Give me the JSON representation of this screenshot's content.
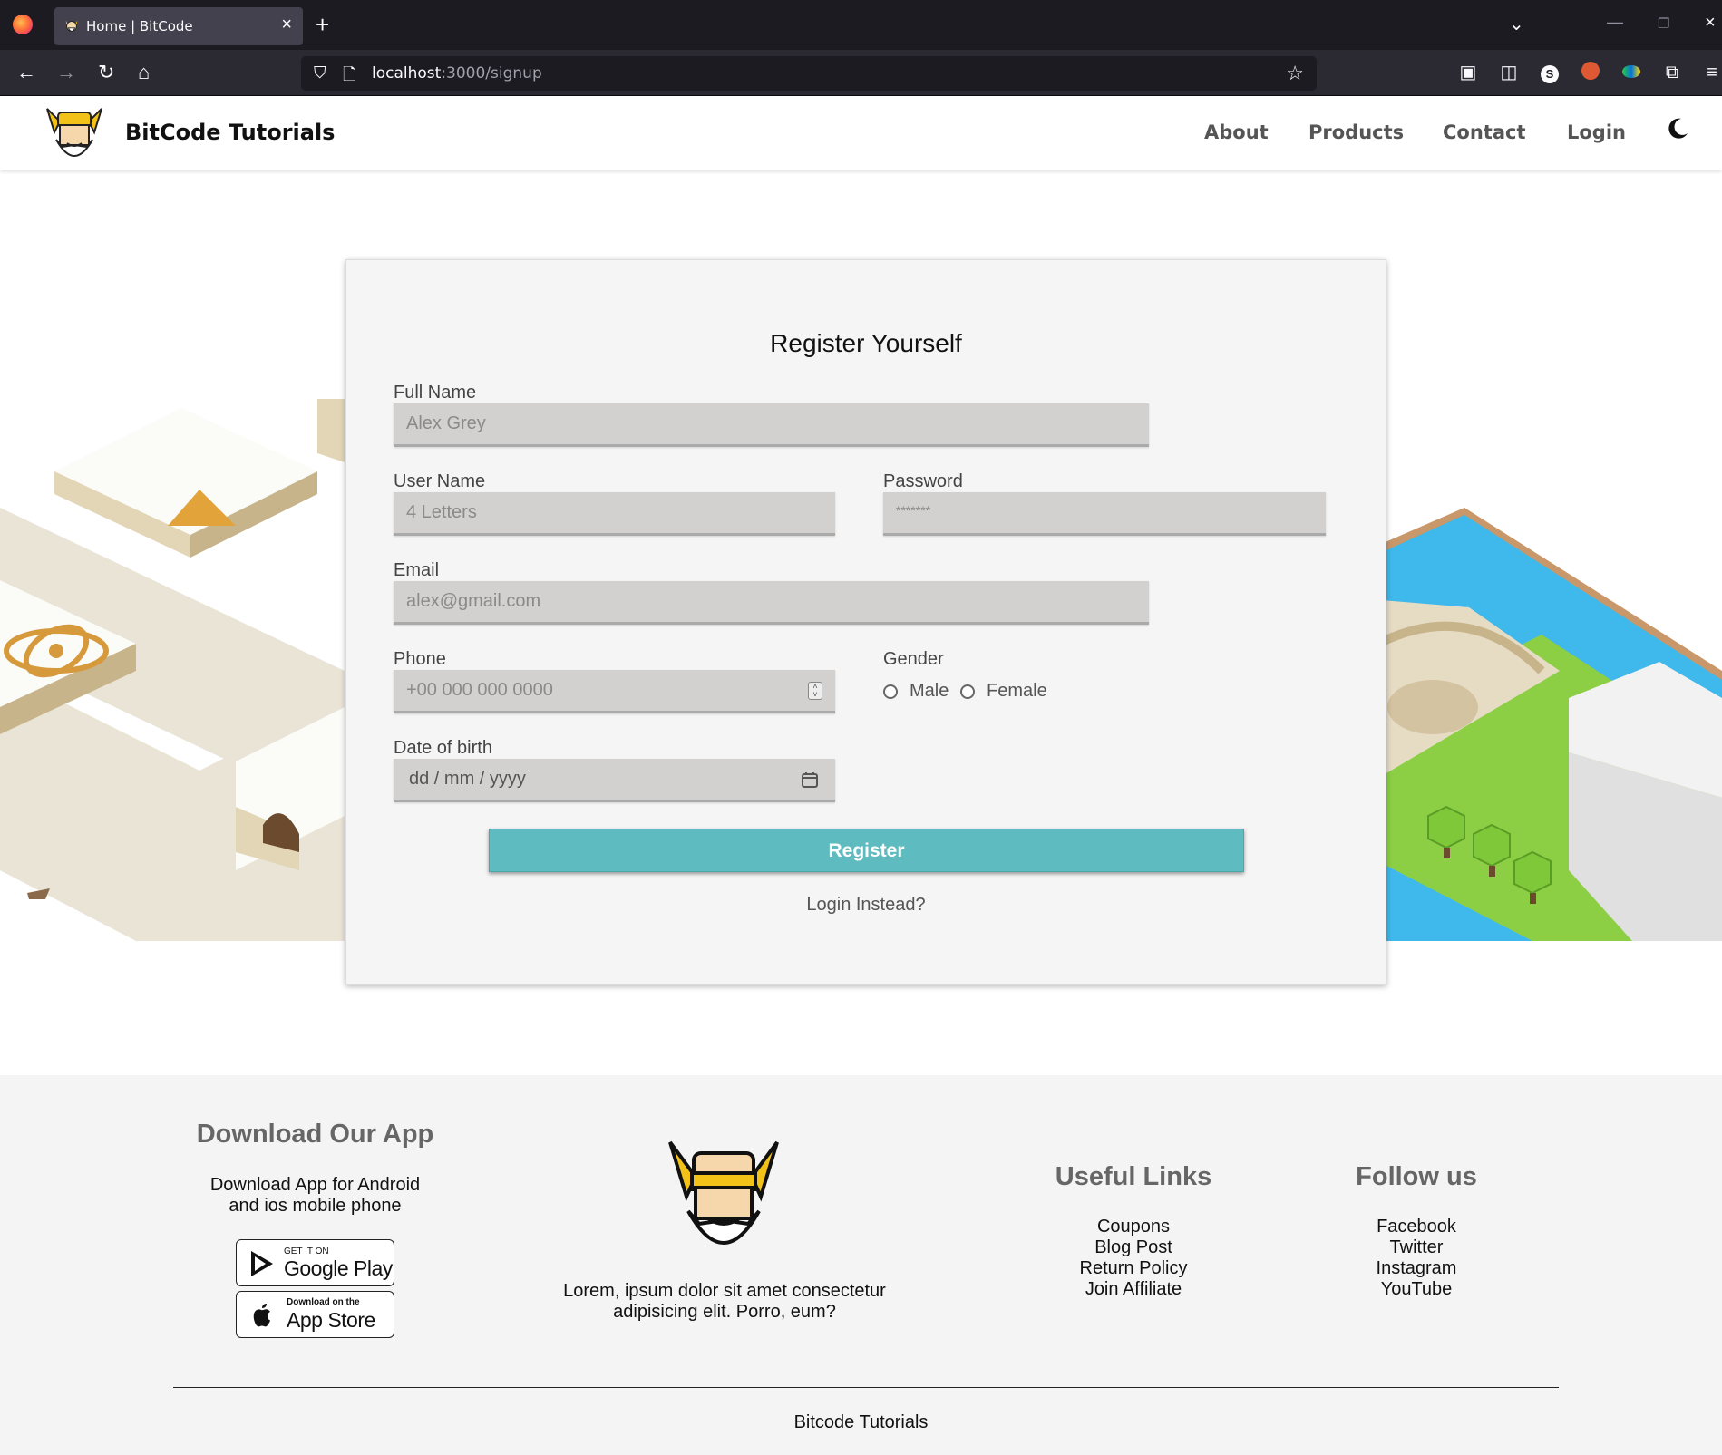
{
  "browser": {
    "tab_title": "Home | BitCode",
    "url_host": "localhost",
    "url_rest": ":3000/signup"
  },
  "header": {
    "brand": "BitCode Tutorials",
    "nav": [
      "About",
      "Products",
      "Contact",
      "Login"
    ]
  },
  "form": {
    "title": "Register Yourself",
    "full_name_label": "Full Name",
    "full_name_placeholder": "Alex Grey",
    "username_label": "User Name",
    "username_placeholder": "4 Letters",
    "password_label": "Password",
    "password_placeholder": "*******",
    "email_label": "Email",
    "email_placeholder": "alex@gmail.com",
    "phone_label": "Phone",
    "phone_placeholder": "+00 000 000 0000",
    "gender_label": "Gender",
    "gender_options": [
      "Male",
      "Female"
    ],
    "dob_label": "Date of birth",
    "dob_value": "dd / mm / yyyy",
    "register_label": "Register",
    "login_instead": "Login Instead?"
  },
  "footer": {
    "app_heading": "Download Our App",
    "app_text_line1": "Download App for Android",
    "app_text_line2": "and ios mobile phone",
    "google_small": "GET IT ON",
    "google_big": "Google Play",
    "apple_small": "Download on the",
    "apple_big": "App Store",
    "about_line1": "Lorem, ipsum dolor sit amet consectetur",
    "about_line2": "adipisicing elit. Porro, eum?",
    "links_heading": "Useful Links",
    "links": [
      "Coupons",
      "Blog Post",
      "Return Policy",
      "Join Affiliate"
    ],
    "follow_heading": "Follow us",
    "social": [
      "Facebook",
      "Twitter",
      "Instagram",
      "YouTube"
    ],
    "copyright": "Bitcode Tutorials"
  },
  "colors": {
    "accent": "#5ebbbf",
    "input_bg": "#d3d0d0",
    "card_bg": "#f5f5f5",
    "browser_dark": "#1c1b22"
  }
}
